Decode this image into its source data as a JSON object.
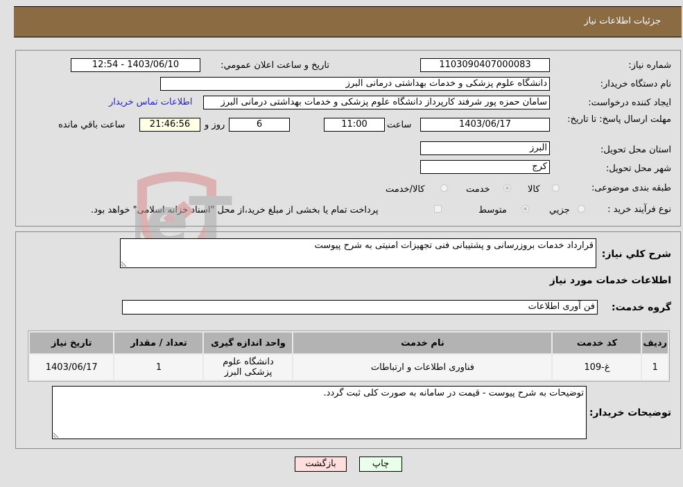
{
  "header": {
    "title": "جزئیات اطلاعات نیاز"
  },
  "details": {
    "need_number_label": "شماره نیاز:",
    "need_number": "1103090407000083",
    "announce_label": "تاریخ و ساعت اعلان عمومي:",
    "announce_value": "1403/06/10 - 12:54",
    "buyer_org_label": "نام دستگاه خریدار:",
    "buyer_org": "دانشگاه علوم پزشکی و خدمات بهداشتی  درمانی البرز",
    "creator_label": "ایجاد کننده درخواست:",
    "creator": "سامان حمزه پور شرفند کارپرداز دانشگاه علوم پزشکی و خدمات بهداشتی  درمانی البرز",
    "contact_link": "اطلاعات تماس خریدار",
    "deadline_label": "مهلت ارسال پاسخ: تا تاریخ:",
    "deadline_date": "1403/06/17",
    "time_label": "ساعت",
    "deadline_time": "11:00",
    "days": "6",
    "days_label": "روز و",
    "remaining_time": "21:46:56",
    "remaining_label": "ساعت باقي مانده",
    "province_label": "استان محل تحویل:",
    "province": "البرز",
    "city_label": "شهر محل تحویل:",
    "city": "کرج",
    "category_label": "طبقه بندی موضوعی:",
    "category_options": [
      "کالا",
      "خدمت",
      "کالا/خدمت"
    ],
    "category_selected": "خدمت",
    "process_label": "نوع فرآیند خرید :",
    "process_options": [
      "جزیي",
      "متوسط"
    ],
    "process_selected": "متوسط",
    "treasury_note": "پرداخت تمام یا بخشی از مبلغ خرید،از محل \"اسناد خزانه اسلامی\" خواهد بود."
  },
  "need": {
    "summary_label": "شرح کلي نیاز:",
    "summary": "قرارداد خدمات بروزرسانی و پشتیبانی فنی تجهیزات امنیتی به شرح پیوست",
    "services_heading": "اطلاعات خدمات مورد نیاز",
    "service_group_label": "گروه خدمت:",
    "service_group": "فن آوری اطلاعات"
  },
  "table": {
    "columns": [
      "ردیف",
      "کد خدمت",
      "نام خدمت",
      "واحد اندازه گیری",
      "تعداد / مقدار",
      "تاریخ نیاز"
    ],
    "rows": [
      [
        "1",
        "غ-109",
        "فناوری اطلاعات و ارتباطات",
        "دانشگاه علوم پزشکی البرز",
        "1",
        "1403/06/17"
      ]
    ]
  },
  "buyer_notes": {
    "label": "توضیحات خریدار:",
    "text": "توضیحات به شرح پیوست - قیمت در سامانه به صورت کلی ثبت گردد."
  },
  "buttons": {
    "print": "چاپ",
    "back": "بازگشت"
  },
  "watermark": {
    "text": "AriaTender.neT"
  },
  "colors": {
    "header_bg": "#8b6b42",
    "print_bg": "#eaffea",
    "back_bg": "#ffdede",
    "link": "#2222cc"
  }
}
